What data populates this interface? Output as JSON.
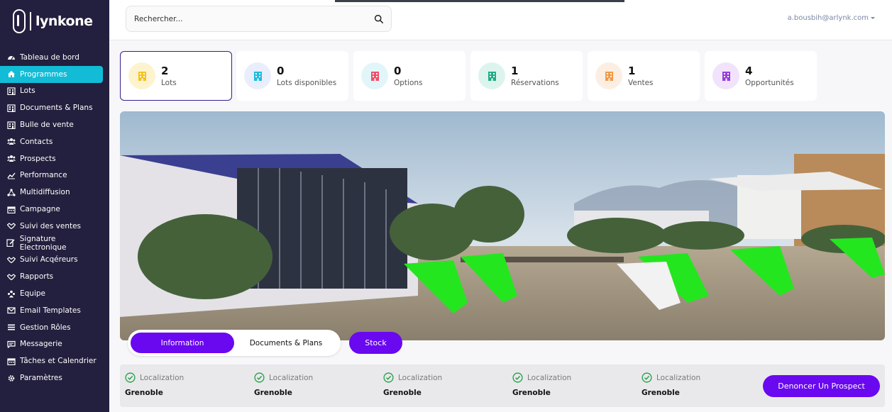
{
  "brand": {
    "name": "lynkone"
  },
  "sidebar": {
    "items": [
      {
        "label": "Tableau de bord",
        "icon": "dashboard-icon"
      },
      {
        "label": "Programmes",
        "icon": "home-icon",
        "active": true
      },
      {
        "label": "Lots",
        "icon": "building-icon"
      },
      {
        "label": "Documents & Plans",
        "icon": "building-icon"
      },
      {
        "label": "Bulle de vente",
        "icon": "building-icon"
      },
      {
        "label": "Contacts",
        "icon": "users-icon"
      },
      {
        "label": "Prospects",
        "icon": "users-icon"
      },
      {
        "label": "Performance",
        "icon": "chart-icon"
      },
      {
        "label": "Multidiffusion",
        "icon": "share-icon"
      },
      {
        "label": "Campagne",
        "icon": "calendar-icon"
      },
      {
        "label": "Suivi des ventes",
        "icon": "handshake-icon"
      },
      {
        "label": "Signature Electronique",
        "icon": "signature-icon"
      },
      {
        "label": "Suivi Acqéreurs",
        "icon": "handshake-icon"
      },
      {
        "label": "Rapports",
        "icon": "handshake-icon"
      },
      {
        "label": "Equipe",
        "icon": "team-icon"
      },
      {
        "label": "Email Templates",
        "icon": "envelope-icon"
      },
      {
        "label": "Gestion Rôles",
        "icon": "list-icon"
      },
      {
        "label": "Messagerie",
        "icon": "message-icon"
      },
      {
        "label": "Tâches et Calendrier",
        "icon": "calendar-icon"
      },
      {
        "label": "Paramètres",
        "icon": "gear-icon"
      }
    ]
  },
  "topbar": {
    "search_placeholder": "Rechercher...",
    "user_email": "a.bousbih@arlynk.com"
  },
  "stats": [
    {
      "value": "2",
      "label": "Lots",
      "color": "#f5c518",
      "bg": "#fdf3cf",
      "selected": true
    },
    {
      "value": "0",
      "label": "Lots disponibles",
      "color": "#1bbde0",
      "bg": "#e9eefc"
    },
    {
      "value": "0",
      "label": "Options",
      "color": "#ee4f6a",
      "bg": "#e2f6f9"
    },
    {
      "value": "1",
      "label": "Réservations",
      "color": "#1fae86",
      "bg": "#ddf4ee"
    },
    {
      "value": "1",
      "label": "Ventes",
      "color": "#f59a45",
      "bg": "#fdeee3"
    },
    {
      "value": "4",
      "label": "Opportunités",
      "color": "#9a3ddc",
      "bg": "#f1e3fb"
    }
  ],
  "tabs": {
    "information": "Information",
    "documents": "Documents & Plans",
    "stock": "Stock"
  },
  "info": [
    {
      "label": "Localization",
      "value": "Grenoble"
    },
    {
      "label": "Localization",
      "value": "Grenoble"
    },
    {
      "label": "Localization",
      "value": "Grenoble"
    },
    {
      "label": "Localization",
      "value": "Grenoble"
    },
    {
      "label": "Localization",
      "value": "Grenoble"
    }
  ],
  "actions": {
    "denounce": "Denoncer Un Prospect"
  },
  "colors": {
    "sidebar": "#231f3e",
    "active": "#12bcd6",
    "primary": "#6a08f0",
    "check": "#2ea44f"
  }
}
